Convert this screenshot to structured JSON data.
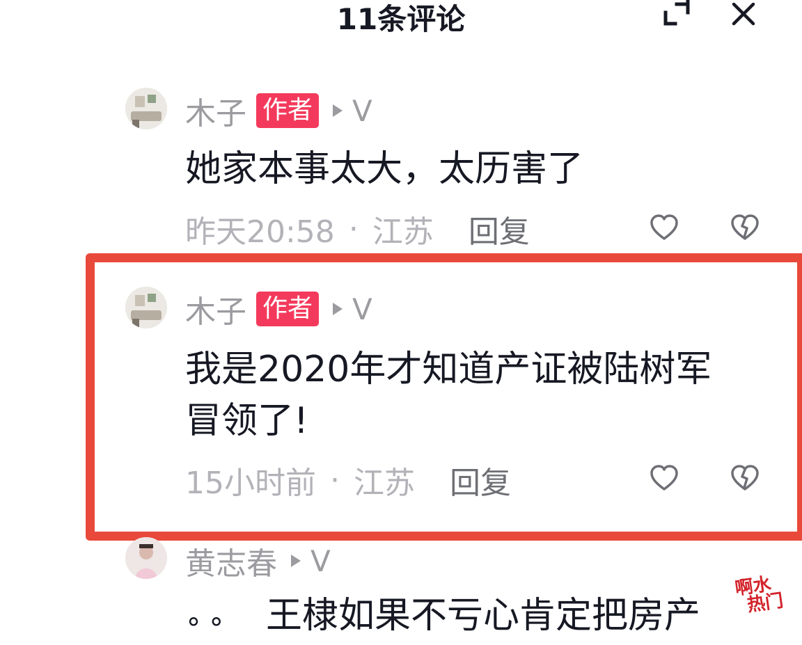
{
  "header": {
    "title": "11条评论"
  },
  "comments": [
    {
      "author": "木子",
      "badge": "作者",
      "reply_to": "V",
      "text_lines": [
        "她家本事太大，太历害了"
      ],
      "time": "昨天20:58",
      "location": "江苏",
      "reply_label": "回复"
    },
    {
      "author": "木子",
      "badge": "作者",
      "reply_to": "V",
      "text_lines": [
        "我是2020年才知道产证被陆树军",
        "冒领了!"
      ],
      "time": "15小时前",
      "location": "江苏",
      "reply_label": "回复"
    },
    {
      "author": "黄志春",
      "reply_to": "V",
      "text_lines": [
        "王棣如果不亏心肯定把房产"
      ]
    }
  ],
  "meta_separator": "·",
  "emoji_partial": "° °",
  "watermark": {
    "line1": "啊水",
    "line2": "热门"
  },
  "colors": {
    "badge": "#f43a5c",
    "highlight": "#e9493a",
    "muted": "#9b9ba0"
  }
}
